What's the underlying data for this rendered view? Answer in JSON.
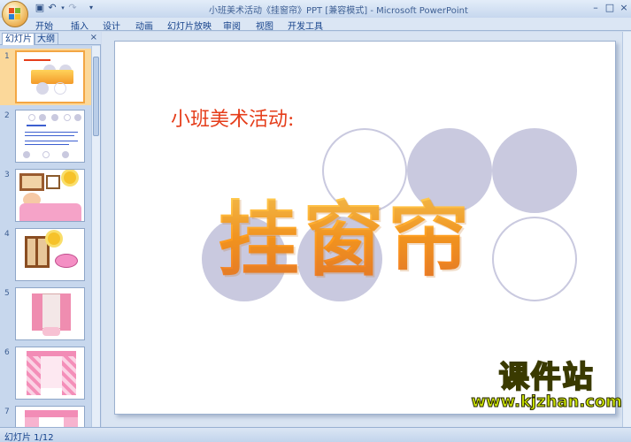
{
  "window": {
    "title": "小班美术活动《挂窗帘》PPT [兼容模式] - Microsoft PowerPoint"
  },
  "ribbon": {
    "tabs": [
      "开始",
      "插入",
      "设计",
      "动画",
      "幻灯片放映",
      "审阅",
      "视图",
      "开发工具"
    ]
  },
  "panel": {
    "tabs": [
      "幻灯片",
      "大纲"
    ],
    "close_label": "×",
    "thumbnails": [
      {
        "number": "1",
        "selected": true
      },
      {
        "number": "2",
        "selected": false
      },
      {
        "number": "3",
        "selected": false
      },
      {
        "number": "4",
        "selected": false
      },
      {
        "number": "5",
        "selected": false
      },
      {
        "number": "6",
        "selected": false
      },
      {
        "number": "7",
        "selected": false
      }
    ]
  },
  "slide": {
    "subtitle": "小班美术活动:",
    "title": "挂窗帘",
    "circle_color": "#c9c9df",
    "subtitle_color": "#e53d1a",
    "title_color": "#f3a12d"
  },
  "watermark": {
    "main": "课件站",
    "url": "www.kjzhan.com"
  },
  "status": {
    "text": "幻灯片 1/12"
  }
}
